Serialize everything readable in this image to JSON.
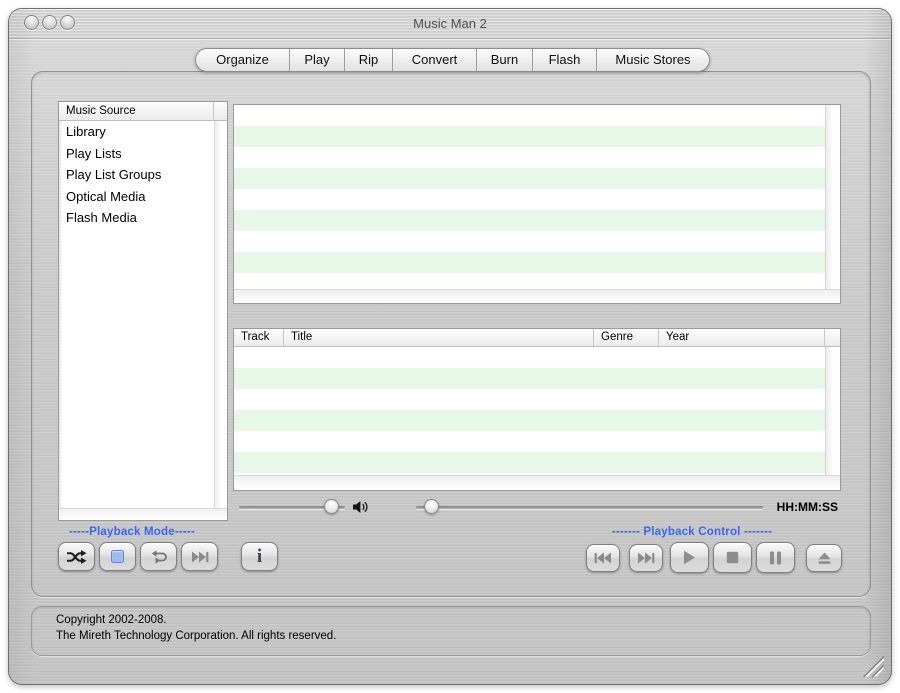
{
  "window": {
    "title": "Music Man 2"
  },
  "tabs": [
    "Organize",
    "Play",
    "Rip",
    "Convert",
    "Burn",
    "Flash",
    "Music Stores"
  ],
  "sidebar": {
    "header": "Music Source",
    "items": [
      "Library",
      "Play Lists",
      "Play List Groups",
      "Optical Media",
      "Flash Media"
    ]
  },
  "track_table": {
    "columns": [
      "Track",
      "Title",
      "Genre",
      "Year"
    ]
  },
  "transport": {
    "time_display": "HH:MM:SS"
  },
  "playback_mode": {
    "label": "-----Playback Mode-----",
    "buttons": [
      "shuffle-icon",
      "stop-blue-icon",
      "repeat-icon",
      "skip-next-icon"
    ]
  },
  "info_button": {
    "label": "i"
  },
  "playback_control": {
    "label": "------- Playback Control -------",
    "buttons": [
      "previous-icon",
      "next-icon",
      "play-icon",
      "stop-icon",
      "pause-icon",
      "eject-icon"
    ]
  },
  "footer": {
    "line1": "Copyright 2002-2008.",
    "line2": "The Mireth Technology Corporation. All rights reserved."
  },
  "colors": {
    "stripe_green": "#e7f7e8",
    "label_blue": "#3a66f2"
  }
}
